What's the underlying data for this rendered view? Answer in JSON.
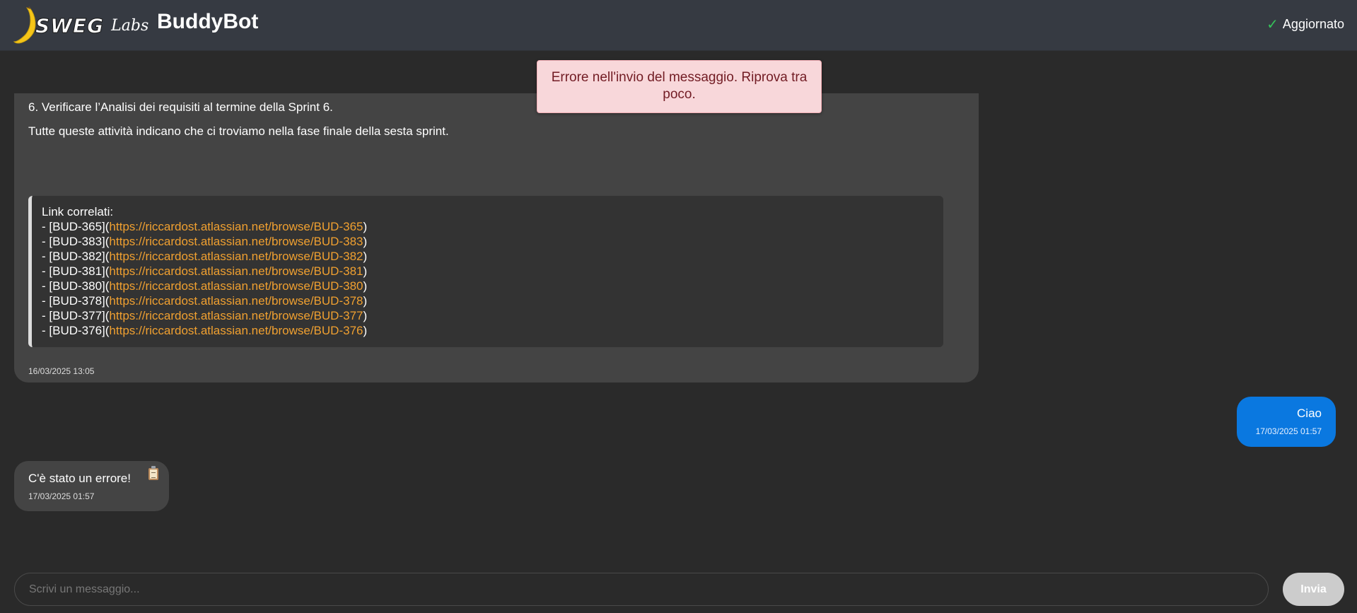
{
  "header": {
    "logo_text": "SWEG",
    "logo_sub": "Labs",
    "title": "BuddyBot",
    "status_icon": "check-icon",
    "status_text": "Aggiornato",
    "colors": {
      "header_bg": "#363a42",
      "status_check": "#35c25a"
    }
  },
  "toast": {
    "text": "Errore nell'invio del messaggio. Riprova tra poco.",
    "colors": {
      "bg": "#f8d7da",
      "text": "#721c24"
    }
  },
  "messages": {
    "bot_long": {
      "line_step": "6. Verificare l’Analisi dei requisiti al termine della Sprint 6.",
      "summary": "Tutte queste attività indicano che ci troviamo nella fase finale della sesta sprint.",
      "links_title": "Link correlati:",
      "links": [
        {
          "prefix": "- [BUD-365](",
          "url": "https://riccardost.atlassian.net/browse/BUD-365",
          "suffix": ")"
        },
        {
          "prefix": "- [BUD-383](",
          "url": "https://riccardost.atlassian.net/browse/BUD-383",
          "suffix": ")"
        },
        {
          "prefix": "- [BUD-382](",
          "url": "https://riccardost.atlassian.net/browse/BUD-382",
          "suffix": ")"
        },
        {
          "prefix": "- [BUD-381](",
          "url": "https://riccardost.atlassian.net/browse/BUD-381",
          "suffix": ")"
        },
        {
          "prefix": "- [BUD-380](",
          "url": "https://riccardost.atlassian.net/browse/BUD-380",
          "suffix": ")"
        },
        {
          "prefix": "- [BUD-378](",
          "url": "https://riccardost.atlassian.net/browse/BUD-378",
          "suffix": ")"
        },
        {
          "prefix": "- [BUD-377](",
          "url": "https://riccardost.atlassian.net/browse/BUD-377",
          "suffix": ")"
        },
        {
          "prefix": "- [BUD-376](",
          "url": "https://riccardost.atlassian.net/browse/BUD-376",
          "suffix": ")"
        }
      ],
      "timestamp": "16/03/2025 13:05"
    },
    "user": {
      "text": "Ciao",
      "timestamp": "17/03/2025 01:57",
      "color": "#0a78e0"
    },
    "bot_error": {
      "text": "C'è stato un errore!",
      "timestamp": "17/03/2025 01:57",
      "copy_icon": "clipboard-icon"
    }
  },
  "composer": {
    "placeholder": "Scrivi un messaggio...",
    "value": "",
    "send_label": "Invia"
  }
}
